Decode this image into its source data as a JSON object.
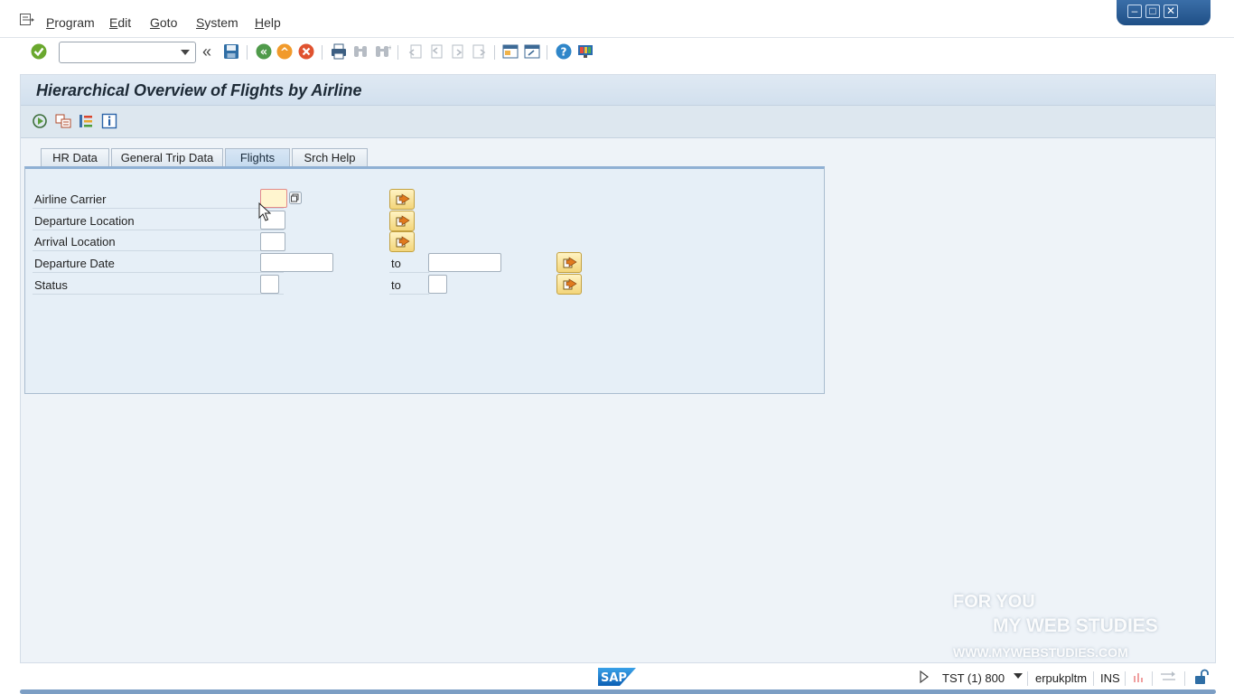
{
  "menu": {
    "items": [
      {
        "label": "Program",
        "key": "P"
      },
      {
        "label": "Edit",
        "key": "E"
      },
      {
        "label": "Goto",
        "key": "G"
      },
      {
        "label": "System",
        "key": "S"
      },
      {
        "label": "Help",
        "key": "H"
      }
    ]
  },
  "toolbar": {
    "command_field": {
      "value": "",
      "placeholder": ""
    },
    "icons": [
      "enter-icon",
      "save-icon",
      "back-icon",
      "exit-icon",
      "cancel-icon",
      "print-icon",
      "find-icon",
      "find-next-icon",
      "first-page-icon",
      "previous-page-icon",
      "next-page-icon",
      "last-page-icon",
      "new-session-icon",
      "shortcut-icon",
      "help-icon",
      "customize-layout-icon"
    ]
  },
  "page": {
    "title": "Hierarchical Overview of Flights by Airline",
    "app_icons": [
      "execute-icon",
      "get-variant-icon",
      "selection-options-icon",
      "info-icon"
    ]
  },
  "tabs": [
    {
      "label": "HR Data",
      "active": false
    },
    {
      "label": "General Trip Data",
      "active": false
    },
    {
      "label": "Flights",
      "active": true
    },
    {
      "label": "Srch Help",
      "active": false
    }
  ],
  "form": {
    "airline_carrier": {
      "label": "Airline Carrier",
      "value": ""
    },
    "departure_location": {
      "label": "Departure Location",
      "value": ""
    },
    "arrival_location": {
      "label": "Arrival Location",
      "value": ""
    },
    "departure_date": {
      "label": "Departure Date",
      "from": "",
      "to_label": "to",
      "to": ""
    },
    "status": {
      "label": "Status",
      "from": "",
      "to_label": "to",
      "to": ""
    }
  },
  "statusbar": {
    "logo": "SAP",
    "system": "TST (1) 800",
    "user": "erpukpltm",
    "mode": "INS"
  },
  "watermark": {
    "line1": "FOR YOU",
    "line2": "MY WEB STUDIES",
    "line3": "WWW.MYWEBSTUDIES.COM"
  },
  "colors": {
    "accent": "#3a6ea8",
    "panel": "#e6eff7",
    "focus_field": "#fff5cf",
    "multi_select_button": "#f3d57a"
  }
}
